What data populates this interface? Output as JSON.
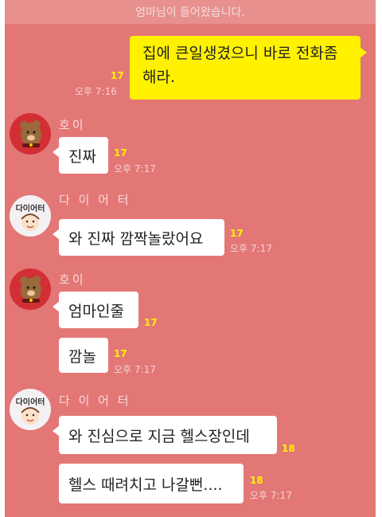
{
  "notice": "엄마님이 들어왔습니다.",
  "my_message": {
    "text": "집에 큰일생겼으니 바로 전화좀 해라.",
    "unread": "17",
    "time": "오후 7:16"
  },
  "groups": [
    {
      "sender": "호이",
      "avatar_icon": "bear-character-icon",
      "messages": [
        {
          "text": "진짜",
          "unread": "17",
          "time": "오후 7:17"
        }
      ]
    },
    {
      "sender": "다 이 어 터",
      "avatar_icon": "dieter-character-icon",
      "avatar_label": "다이어터",
      "messages": [
        {
          "text": "와 진짜 깜짝놀랐어요",
          "unread": "17",
          "time": "오후 7:17"
        }
      ]
    },
    {
      "sender": "호이",
      "avatar_icon": "bear-character-icon",
      "messages": [
        {
          "text": "엄마인줄",
          "unread": "17",
          "time": ""
        },
        {
          "text": "깜놀",
          "unread": "17",
          "time": "오후 7:17"
        }
      ]
    },
    {
      "sender": "다 이 어 터",
      "avatar_icon": "dieter-character-icon",
      "avatar_label": "다이어터",
      "messages": [
        {
          "text": "와 진심으로 지금 헬스장인데",
          "unread": "18",
          "time": ""
        },
        {
          "text": "헬스 때려치고 나갈뻔....",
          "unread": "18",
          "time": "오후 7:17"
        }
      ]
    }
  ],
  "colors": {
    "chat_background": "#e37776",
    "my_bubble": "#fff100",
    "other_bubble": "#ffffff",
    "unread_count": "#fff100"
  }
}
